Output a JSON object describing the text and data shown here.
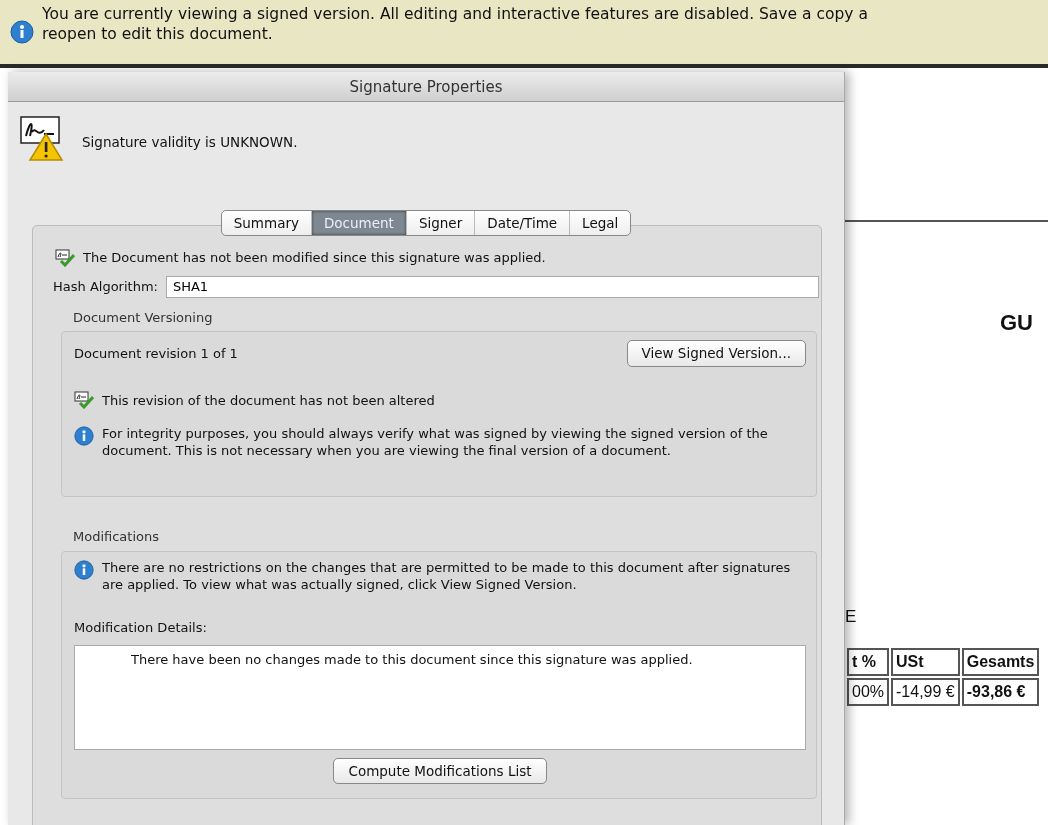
{
  "banner": {
    "message_lines": [
      "You are currently viewing a signed version. All editing and interactive features are disabled. Save a copy a",
      "reopen to edit this document."
    ]
  },
  "dialog": {
    "title": "Signature Properties",
    "status": "Signature validity is UNKNOWN.",
    "tabs": [
      {
        "label": "Summary",
        "selected": false
      },
      {
        "label": "Document",
        "selected": true
      },
      {
        "label": "Signer",
        "selected": false
      },
      {
        "label": "Date/Time",
        "selected": false
      },
      {
        "label": "Legal",
        "selected": false
      }
    ],
    "document_tab": {
      "integrity_message": "The Document has not been modified since this signature was applied.",
      "hash_algorithm": {
        "label": "Hash Algorithm:",
        "value": "SHA1"
      },
      "versioning": {
        "title": "Document Versioning",
        "revision": "Document revision 1 of 1",
        "button": "View Signed Version...",
        "status": "This revision of the document has not been altered",
        "note": "For integrity purposes, you should always verify what was signed by viewing the signed version of the document. This is not necessary when you are viewing the final version of a document."
      },
      "modifications": {
        "title": "Modifications",
        "note": "There are no restrictions on the changes that are permitted to be made to this document after signatures are applied. To view what was actually signed, click View Signed Version.",
        "details_label": "Modification Details:",
        "details": "There have been no changes made to this document since this signature was applied.",
        "button": "Compute Modifications List"
      }
    }
  },
  "document": {
    "heading": "GU",
    "text": "E",
    "table": {
      "columns": [
        "t %",
        "USt",
        "Gesamts"
      ],
      "rows": [
        [
          "00%",
          "-14,99 €",
          "-93,86 €"
        ]
      ]
    }
  }
}
